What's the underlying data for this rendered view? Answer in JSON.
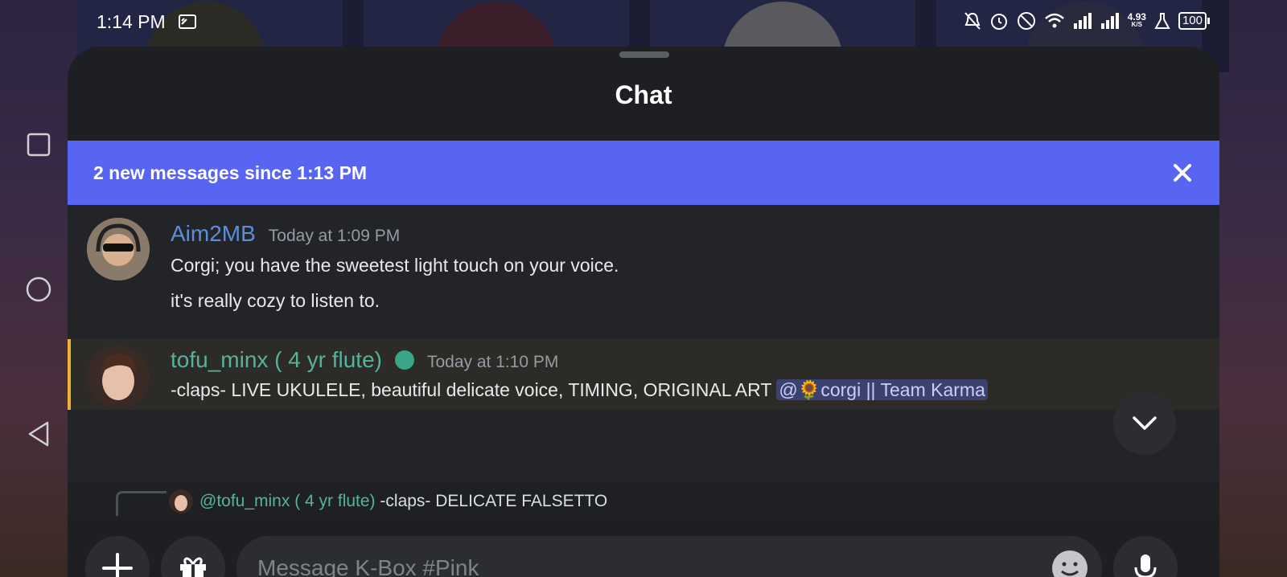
{
  "status_bar": {
    "time": "1:14 PM",
    "network_speed": "4.93",
    "network_unit": "K/S",
    "battery": "100"
  },
  "sheet": {
    "title": "Chat"
  },
  "banner": {
    "text": "2 new messages since 1:13 PM"
  },
  "messages": [
    {
      "username": "Aim2MB",
      "timestamp": "Today at 1:09 PM",
      "lines": [
        "Corgi; you have the sweetest light touch on your voice.",
        "it's really cozy to listen to."
      ],
      "username_color": "#5b8dd9"
    },
    {
      "username": "tofu_minx ( 4 yr flute)",
      "timestamp": "Today at 1:10 PM",
      "text": "-claps- LIVE UKULELE, beautiful delicate voice, TIMING, ORIGINAL ART",
      "mention": "@🌻corgi || Team Karma",
      "username_color": "#55b39d"
    }
  ],
  "reply_preview": {
    "mention": "@tofu_minx ( 4 yr flute)",
    "text": "-claps- DELICATE FALSETTO"
  },
  "composer": {
    "placeholder": "Message K-Box #Pink"
  },
  "colors": {
    "accent": "#5865f2",
    "highlight": "#f0b232",
    "online": "#3ba58c"
  }
}
